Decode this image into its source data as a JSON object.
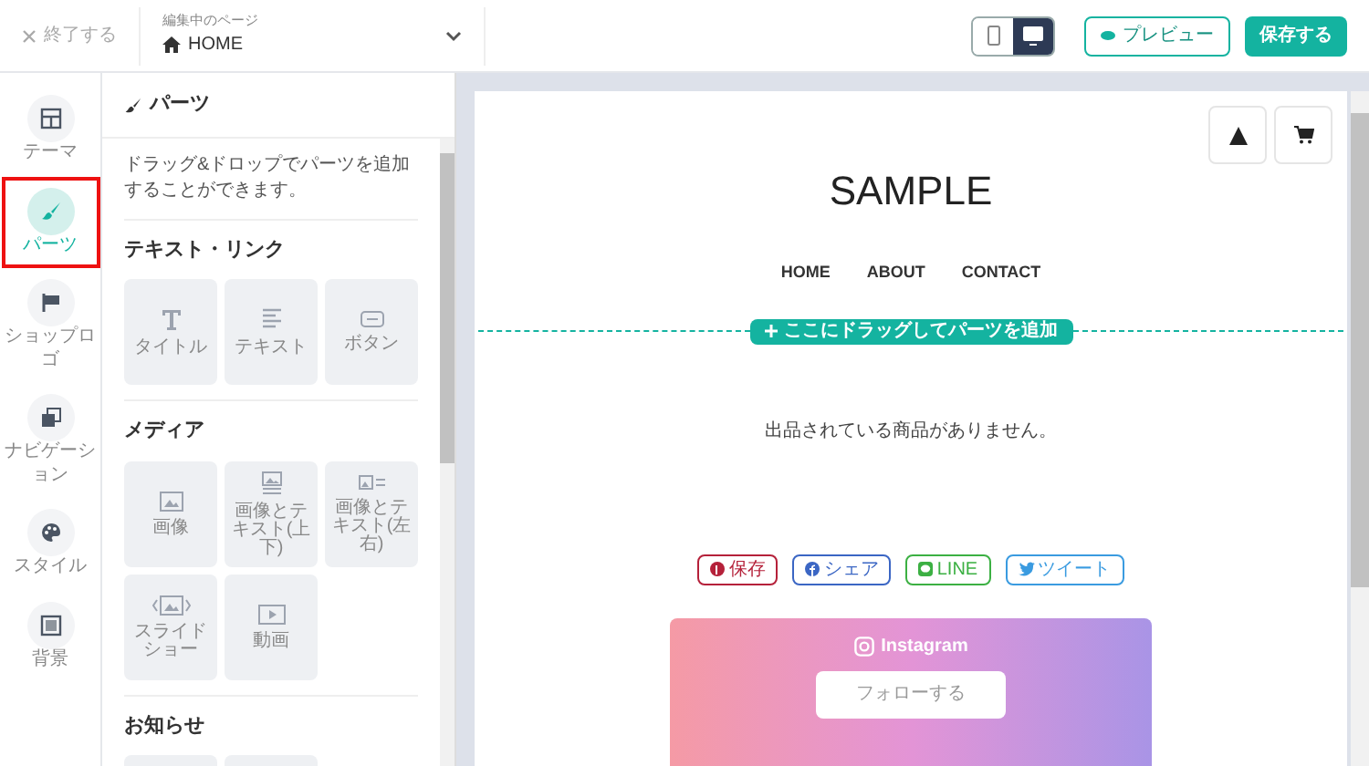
{
  "header": {
    "close_label": "終了する",
    "page_caption": "編集中のページ",
    "page_name": "HOME",
    "devices": [
      {
        "kind": "mobile",
        "selected": false
      },
      {
        "kind": "desktop",
        "selected": true
      }
    ],
    "preview_label": "プレビュー",
    "save_label": "保存する"
  },
  "rail": [
    {
      "kind": "theme",
      "label": "テーマ",
      "selected": false,
      "highlighted": false
    },
    {
      "kind": "parts",
      "label": "パーツ",
      "selected": true,
      "highlighted": true
    },
    {
      "kind": "logo",
      "label": "ショップロゴ",
      "selected": false,
      "highlighted": false
    },
    {
      "kind": "navigation",
      "label": "ナビゲーション",
      "selected": false,
      "highlighted": false
    },
    {
      "kind": "style",
      "label": "スタイル",
      "selected": false,
      "highlighted": false
    },
    {
      "kind": "background",
      "label": "背景",
      "selected": false,
      "highlighted": false
    }
  ],
  "panel": {
    "title": "パーツ",
    "description": "ドラッグ&ドロップでパーツを追加することができます。",
    "sections": [
      {
        "title": "テキスト・リンク",
        "parts": [
          {
            "kind": "title",
            "label": "タイトル"
          },
          {
            "kind": "text",
            "label": "テキスト"
          },
          {
            "kind": "button",
            "label": "ボタン"
          }
        ]
      },
      {
        "title": "メディア",
        "parts": [
          {
            "kind": "image",
            "label": "画像"
          },
          {
            "kind": "image_text_vertical",
            "label": "画像とテキスト(上下)"
          },
          {
            "kind": "image_text_horizontal",
            "label": "画像とテキスト(左右)"
          },
          {
            "kind": "slideshow",
            "label": "スライドショー"
          },
          {
            "kind": "video",
            "label": "動画"
          }
        ]
      },
      {
        "title": "お知らせ",
        "parts": [
          {
            "kind": "blank"
          },
          {
            "kind": "blank"
          }
        ]
      }
    ]
  },
  "canvas": {
    "site_title": "SAMPLE",
    "nav": [
      "HOME",
      "ABOUT",
      "CONTACT"
    ],
    "drop_label": "ここにドラッグしてパーツを追加",
    "empty_message": "出品されている商品がありません。",
    "share_buttons": [
      {
        "kind": "pinterest",
        "label": "保存",
        "color": "#b5213a"
      },
      {
        "kind": "facebook",
        "label": "シェア",
        "color": "#3b66c4"
      },
      {
        "kind": "line",
        "label": "LINE",
        "color": "#3cb043"
      },
      {
        "kind": "twitter",
        "label": "ツイート",
        "color": "#3a9be0"
      }
    ],
    "instagram": {
      "label": "Instagram",
      "button": "フォローする"
    }
  }
}
